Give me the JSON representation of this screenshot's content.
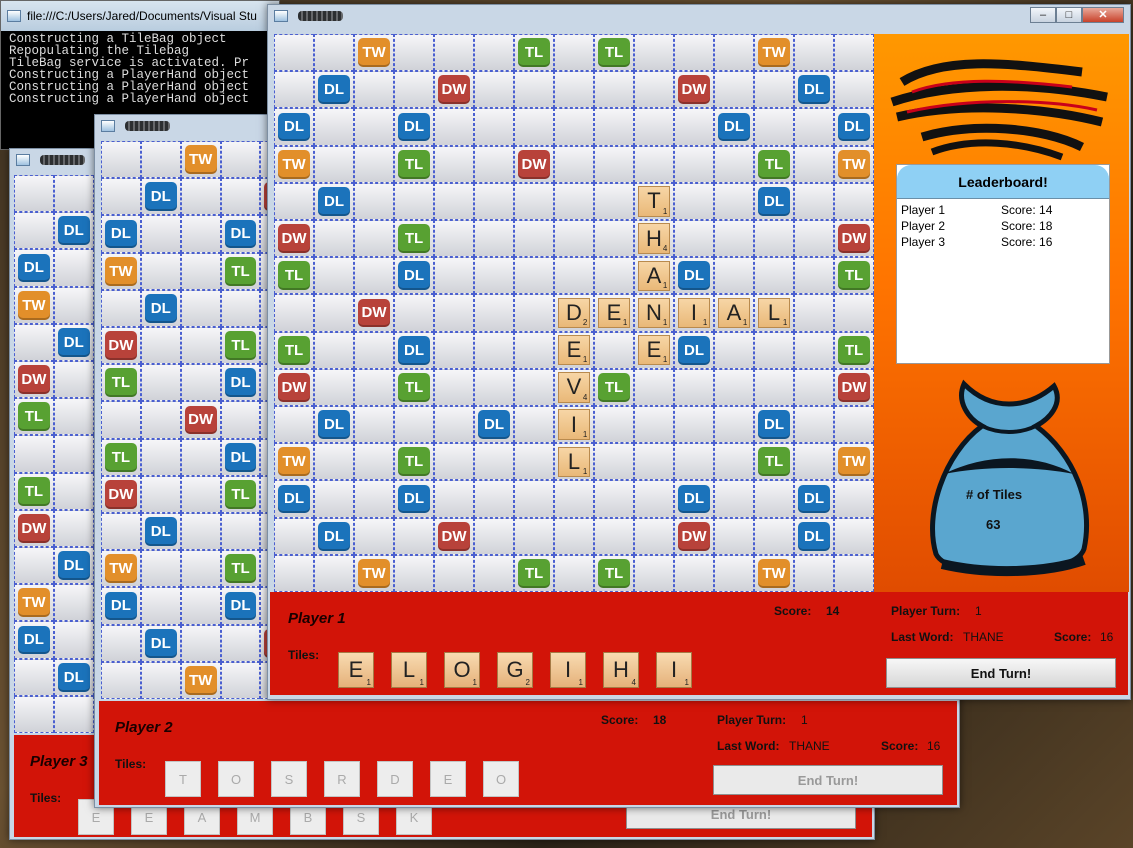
{
  "console": {
    "title": "file:///C:/Users/Jared/Documents/Visual Stu",
    "lines": [
      "Constructing a TileBag object",
      "Repopulating the Tilebag",
      "TileBag service is activated. Pr",
      "Constructing a PlayerHand object",
      "Constructing a PlayerHand object",
      "Constructing a PlayerHand object"
    ]
  },
  "board_row_types": [
    "..T...L.L...T..",
    ".D..W.....W..D.",
    "D..D.......D..D",
    "T..L..W.....L.T",
    ".D..........D..",
    "W..L..........W",
    "L..D......D...L",
    "..W............",
    "L..D......D...L",
    "W..L....L.....W",
    ".D...D.D....D..",
    "T..L........L.T",
    "D..D......D..D.",
    ".D..W.....W..D.",
    "..T...L.L...T.."
  ],
  "windows": [
    {
      "player": "Player 1",
      "tiles_label": "Tiles:",
      "score_label": "Score:",
      "score": "14",
      "turn_label": "Player Turn:",
      "turn": "1",
      "last_word_label": "Last Word:",
      "last_word": "THANE",
      "last_score_label": "Score:",
      "last_score": "16",
      "end_turn": "End Turn!",
      "rack": [
        {
          "l": "E",
          "v": "1"
        },
        {
          "l": "L",
          "v": "1"
        },
        {
          "l": "O",
          "v": "1"
        },
        {
          "l": "G",
          "v": "2"
        },
        {
          "l": "I",
          "v": "1"
        },
        {
          "l": "H",
          "v": "4"
        },
        {
          "l": "I",
          "v": "1"
        }
      ]
    },
    {
      "player": "Player 2",
      "tiles_label": "Tiles:",
      "score_label": "Score:",
      "score": "18",
      "turn_label": "Player Turn:",
      "turn": "1",
      "last_word_label": "Last Word:",
      "last_word": "THANE",
      "last_score_label": "Score:",
      "last_score": "16",
      "end_turn": "End Turn!",
      "rack": [
        "T",
        "O",
        "S",
        "R",
        "D",
        "E",
        "O"
      ]
    },
    {
      "player": "Player 3",
      "tiles_label": "Tiles:",
      "end_turn": "End Turn!",
      "rack": [
        "E",
        "E",
        "A",
        "M",
        "B",
        "S",
        "K"
      ]
    }
  ],
  "placed_tiles": [
    {
      "r": 4,
      "c": 9,
      "l": "T",
      "v": "1"
    },
    {
      "r": 5,
      "c": 9,
      "l": "H",
      "v": "4"
    },
    {
      "r": 6,
      "c": 9,
      "l": "A",
      "v": "1"
    },
    {
      "r": 7,
      "c": 7,
      "l": "D",
      "v": "2"
    },
    {
      "r": 7,
      "c": 8,
      "l": "E",
      "v": "1"
    },
    {
      "r": 7,
      "c": 9,
      "l": "N",
      "v": "1"
    },
    {
      "r": 7,
      "c": 10,
      "l": "I",
      "v": "1"
    },
    {
      "r": 7,
      "c": 11,
      "l": "A",
      "v": "1"
    },
    {
      "r": 7,
      "c": 12,
      "l": "L",
      "v": "1"
    },
    {
      "r": 8,
      "c": 7,
      "l": "E",
      "v": "1"
    },
    {
      "r": 8,
      "c": 9,
      "l": "E",
      "v": "1"
    },
    {
      "r": 9,
      "c": 7,
      "l": "V",
      "v": "4"
    },
    {
      "r": 10,
      "c": 7,
      "l": "I",
      "v": "1"
    },
    {
      "r": 11,
      "c": 7,
      "l": "L",
      "v": "1"
    }
  ],
  "premium_labels": {
    "T": "TW",
    "W": "DW",
    "L": "TL",
    "D": "DL"
  },
  "leaderboard": {
    "title": "Leaderboard!",
    "rows": [
      {
        "player": "Player 1",
        "score": "Score: 14"
      },
      {
        "player": "Player 2",
        "score": "Score: 18"
      },
      {
        "player": "Player 3",
        "score": "Score: 16"
      }
    ]
  },
  "bag": {
    "label": "# of Tiles",
    "count": "63"
  },
  "colors": {
    "panel": "#d21408",
    "tw": "#e28f2a",
    "dw": "#b8423a",
    "tl": "#58a132",
    "dl": "#1b73bb"
  }
}
